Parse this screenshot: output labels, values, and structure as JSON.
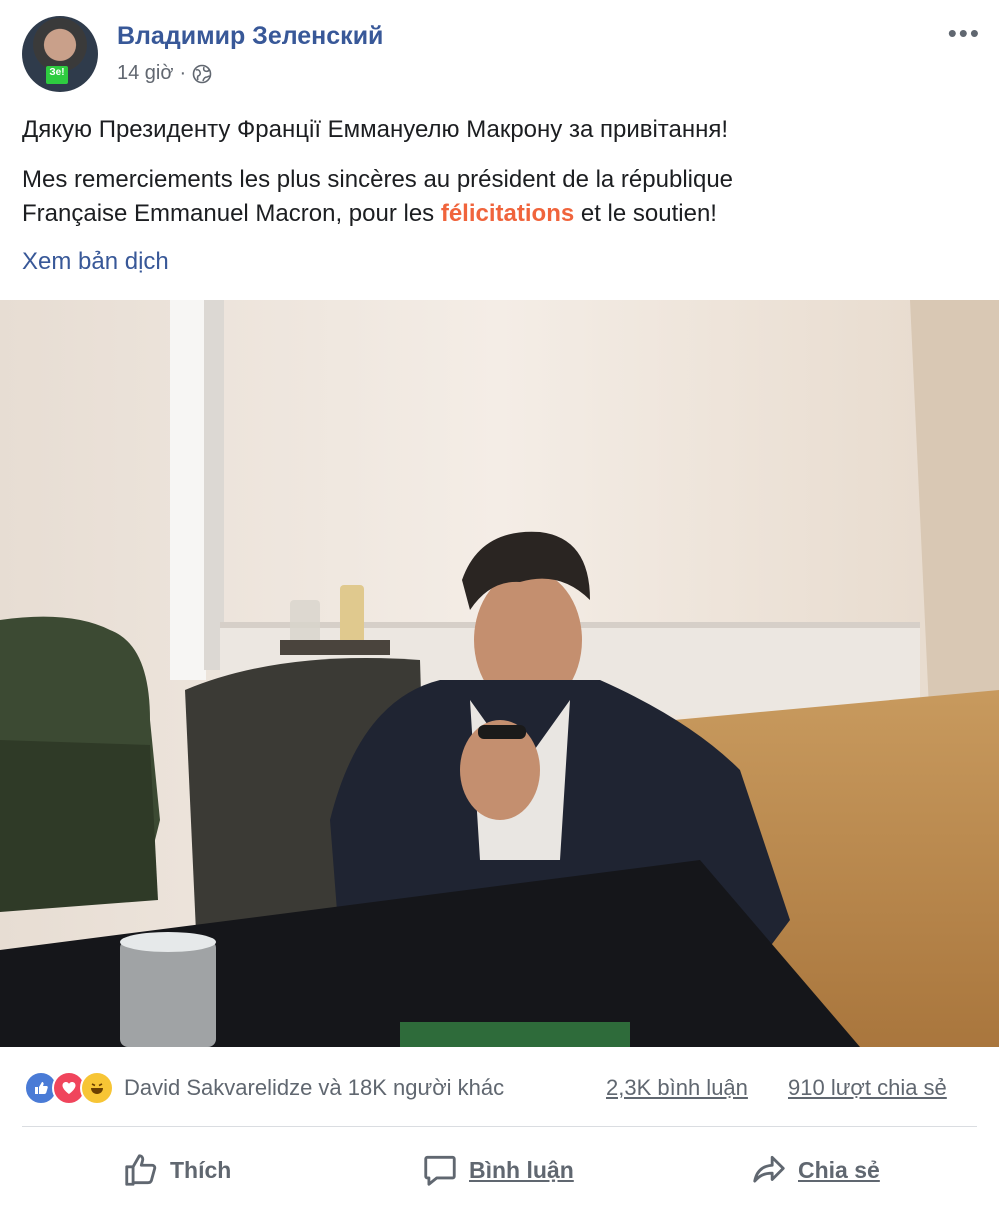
{
  "post": {
    "author": "Владимир Зеленский",
    "time": "14 giờ",
    "separator": "·",
    "avatar_badge": "Зе!",
    "text_ua": "Дякую Президенту Франції Еммануелю Макрону за привітання!",
    "text_fr_1": "Mes remerciements les plus sincères au président de la république",
    "text_fr_2_pre": "Française Emmanuel Macron, pour les ",
    "text_fr_2_highlight": "félicitations",
    "text_fr_2_post": " et le soutien!",
    "translate_link": "Xem bản dịch"
  },
  "stats": {
    "reactions_text": "David Sakvarelidze và 18K người khác",
    "comments": "2,3K bình luận",
    "shares": "910 lượt chia sẻ",
    "reaction_icons": [
      "like-icon",
      "love-icon",
      "haha-icon"
    ]
  },
  "actions": {
    "like": "Thích",
    "comment": "Bình luận",
    "share": "Chia sẻ"
  },
  "colors": {
    "link": "#385898",
    "highlight": "#f0643c",
    "secondary": "#606770"
  }
}
